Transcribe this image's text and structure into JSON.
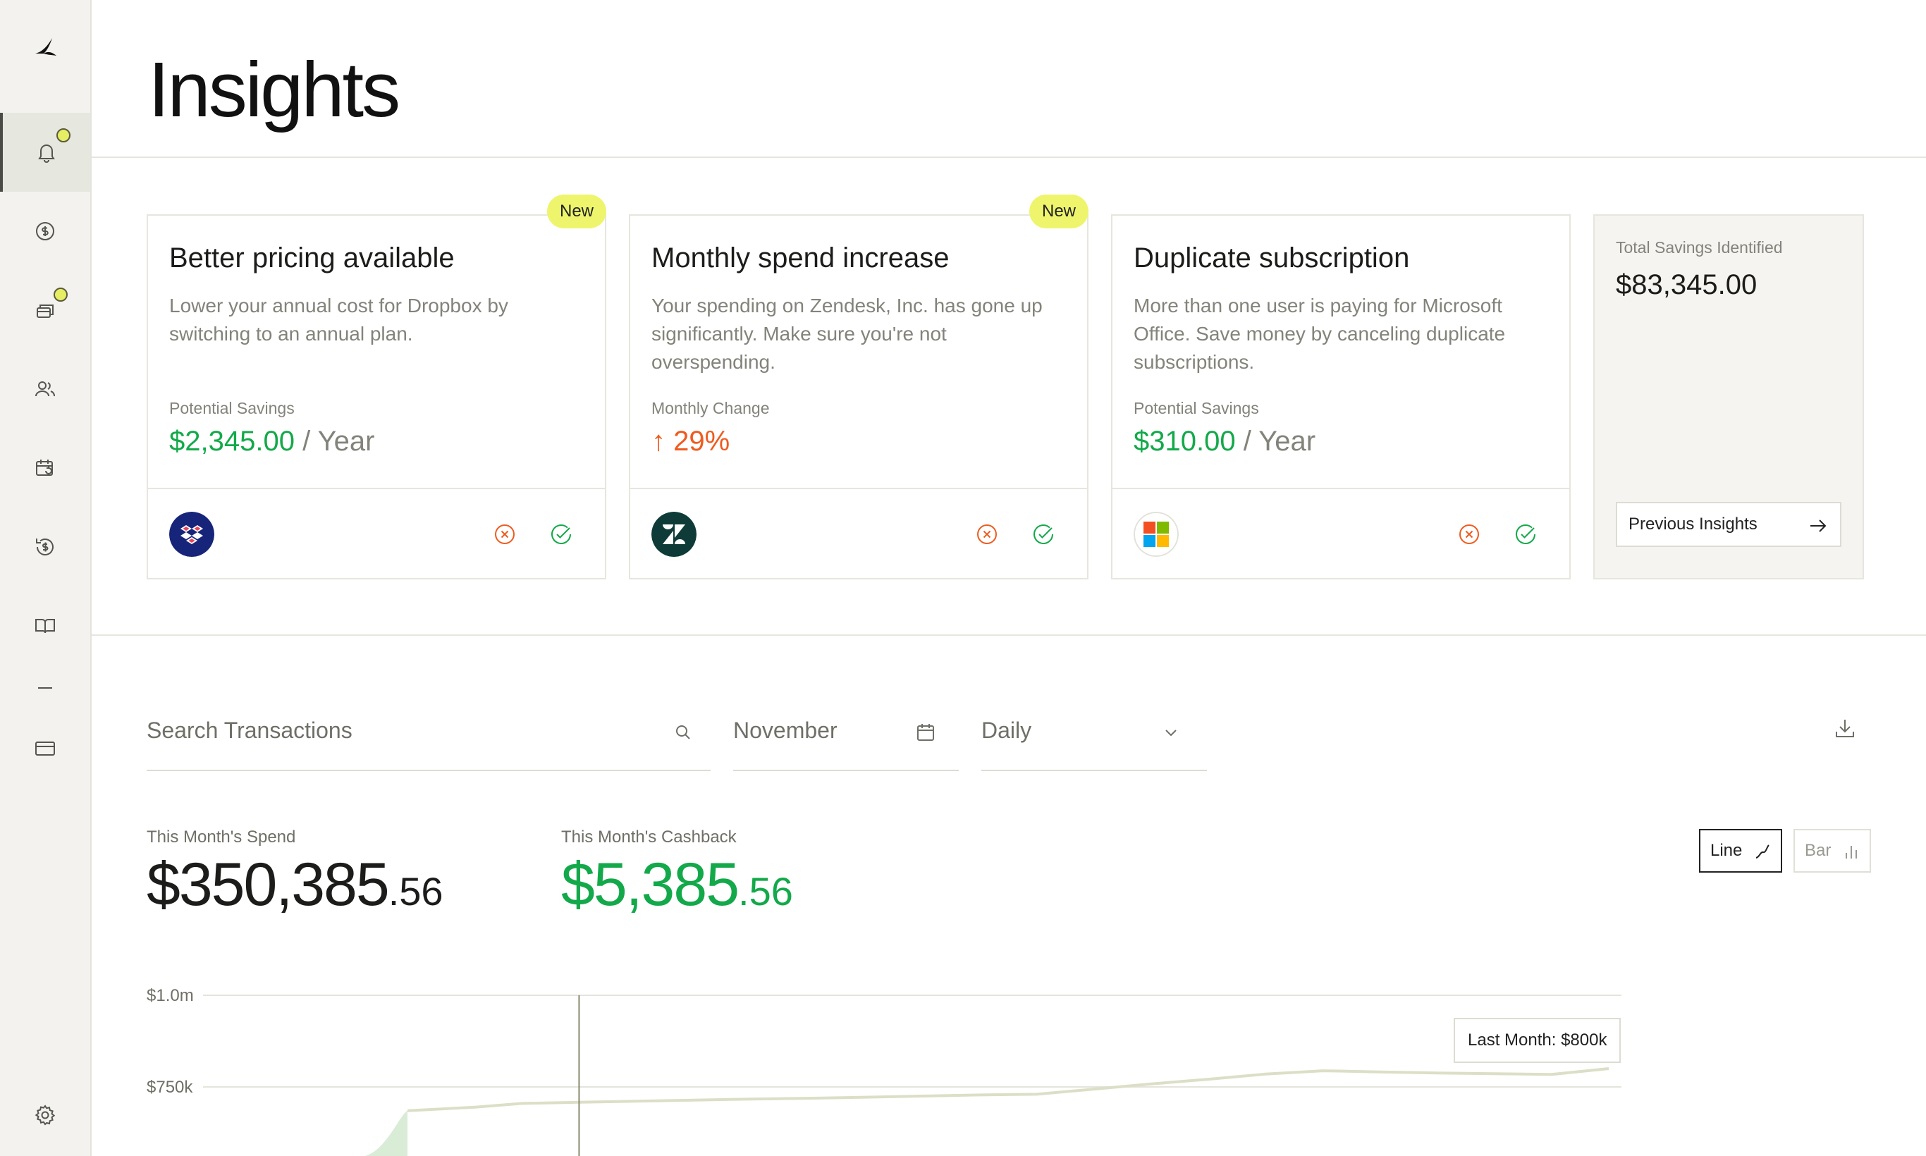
{
  "page": {
    "title": "Insights"
  },
  "sidebar": {
    "items": [
      {
        "name": "notifications",
        "icon": "bell-icon",
        "active": true,
        "has_dot": true
      },
      {
        "name": "spend",
        "icon": "dollar-circle-icon",
        "active": false,
        "has_dot": false
      },
      {
        "name": "subscriptions",
        "icon": "cards-stack-icon",
        "active": false,
        "has_dot": true
      },
      {
        "name": "users",
        "icon": "users-icon",
        "active": false,
        "has_dot": false
      },
      {
        "name": "renewals",
        "icon": "calendar-refresh-icon",
        "active": false,
        "has_dot": false
      },
      {
        "name": "cashback",
        "icon": "cashback-icon",
        "active": false,
        "has_dot": false
      },
      {
        "name": "guides",
        "icon": "book-icon",
        "active": false,
        "has_dot": false
      },
      {
        "name": "card",
        "icon": "credit-card-icon",
        "active": false,
        "has_dot": false
      },
      {
        "name": "settings",
        "icon": "gear-icon",
        "active": false,
        "has_dot": false
      }
    ]
  },
  "insights": [
    {
      "badge": "New",
      "title": "Better pricing available",
      "description": "Lower your annual cost for Dropbox by switching to an annual plan.",
      "metric_label": "Potential Savings",
      "metric_value": "$2,345.00",
      "metric_suffix": " / Year",
      "vendor_icon": "dropbox-logo-icon"
    },
    {
      "badge": "New",
      "title": "Monthly spend increase",
      "description": "Your spending on Zendesk, Inc. has gone up significantly. Make sure you're not overspending.",
      "metric_label": "Monthly Change",
      "metric_value": "29%",
      "metric_arrow": "↑",
      "vendor_icon": "zendesk-logo-icon"
    },
    {
      "title": "Duplicate subscription",
      "description": "More than one user is paying for Microsoft Office. Save money by canceling duplicate subscriptions.",
      "metric_label": "Potential Savings",
      "metric_value": "$310.00",
      "metric_suffix": " / Year",
      "vendor_icon": "microsoft-logo-icon"
    }
  ],
  "total_savings": {
    "label": "Total Savings Identified",
    "value": "$83,345.00",
    "button_label": "Previous Insights"
  },
  "filters": {
    "search_placeholder": "Search Transactions",
    "month": "November",
    "granularity": "Daily"
  },
  "stats": {
    "spend_label": "This Month's Spend",
    "spend_whole": "$350,385",
    "spend_cents": ".56",
    "cashback_label": "This Month's Cashback",
    "cashback_whole": "$5,385",
    "cashback_cents": ".56"
  },
  "chart_toggle": {
    "line_label": "Line",
    "bar_label": "Bar",
    "selected": "Line"
  },
  "chart_data": {
    "type": "line",
    "ylim": [
      0,
      1000000
    ],
    "y_ticks": [
      {
        "value": 1000000,
        "label": "$1.0m"
      },
      {
        "value": 750000,
        "label": "$750k"
      }
    ],
    "series": [
      {
        "values": [
          {
            "x": 0,
            "y": 685000
          },
          {
            "x": 1.2,
            "y": 695000
          },
          {
            "x": 2,
            "y": 705000
          },
          {
            "x": 3,
            "y": 708000
          },
          {
            "x": 4,
            "y": 711000
          },
          {
            "x": 5,
            "y": 714000
          },
          {
            "x": 6,
            "y": 717000
          },
          {
            "x": 7,
            "y": 719000
          },
          {
            "x": 8,
            "y": 722000
          },
          {
            "x": 9,
            "y": 725000
          },
          {
            "x": 10,
            "y": 728000
          },
          {
            "x": 11,
            "y": 730000
          },
          {
            "x": 12,
            "y": 744000
          },
          {
            "x": 13,
            "y": 758000
          },
          {
            "x": 14,
            "y": 771000
          },
          {
            "x": 15,
            "y": 785000
          },
          {
            "x": 16,
            "y": 794000
          },
          {
            "x": 17,
            "y": 791000
          },
          {
            "x": 18,
            "y": 788000
          },
          {
            "x": 19,
            "y": 786000
          },
          {
            "x": 20,
            "y": 784000
          },
          {
            "x": 21,
            "y": 800000
          }
        ]
      }
    ],
    "x_max": 21,
    "cursor_x": 3,
    "tooltip": "Last Month: $800k",
    "colors": {
      "line": "#dcdfc6",
      "area": "#d8ecd6",
      "grid": "#e4e4dc",
      "cursor": "#8a8a6e"
    }
  }
}
